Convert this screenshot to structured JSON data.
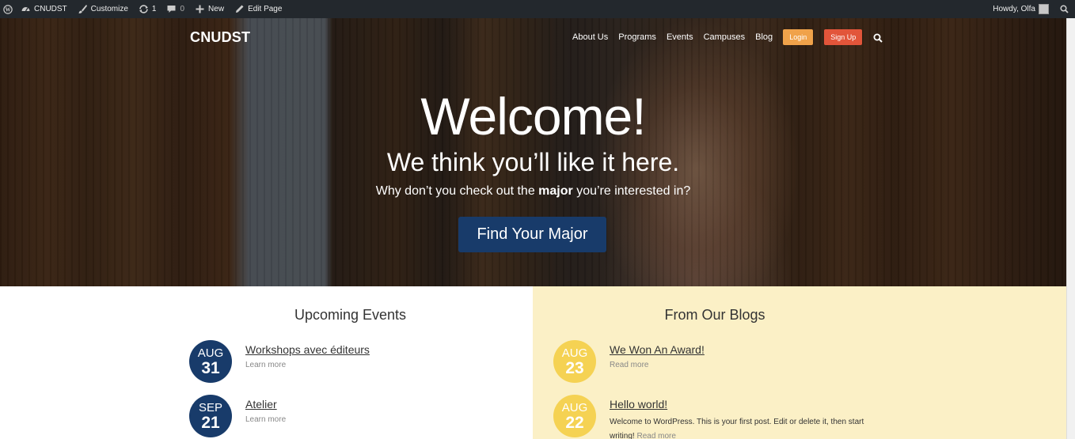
{
  "adminbar": {
    "site_name": "CNUDST",
    "customize": "Customize",
    "updates_count": "1",
    "comments_count": "0",
    "new": "New",
    "edit_page": "Edit Page",
    "howdy": "Howdy, Olfa"
  },
  "header": {
    "logo": "CNUDST",
    "nav": [
      "About Us",
      "Programs",
      "Events",
      "Campuses",
      "Blog"
    ],
    "login": "Login",
    "signup": "Sign Up"
  },
  "hero": {
    "title": "Welcome!",
    "subtitle": "We think you’ll like it here.",
    "line_before": "Why don’t you check out the ",
    "line_bold": "major",
    "line_after": " you’re interested in?",
    "cta": "Find Your Major"
  },
  "events": {
    "title": "Upcoming Events",
    "items": [
      {
        "month": "AUG",
        "day": "31",
        "title": "Workshops avec éditeurs",
        "more": "Learn more"
      },
      {
        "month": "SEP",
        "day": "21",
        "title": "Atelier",
        "more": "Learn more"
      }
    ]
  },
  "blogs": {
    "title": "From Our Blogs",
    "items": [
      {
        "month": "AUG",
        "day": "23",
        "title": "We Won An Award!",
        "more": "Read more",
        "desc": ""
      },
      {
        "month": "AUG",
        "day": "22",
        "title": "Hello world!",
        "more": "Read more",
        "desc": "Welcome to WordPress. This is your first post. Edit or delete it, then start writing!"
      }
    ]
  },
  "colors": {
    "adminbar": "#23282d",
    "brand_blue": "#183b6a",
    "login_orange": "#f0a24a",
    "signup_red": "#e2553a",
    "blog_bg": "#fbf0c6",
    "blog_circle": "#f5d253"
  },
  "icons": {
    "wp": "wordpress-icon",
    "site": "dashboard-icon",
    "customize": "brush-icon",
    "updates": "refresh-icon",
    "comments": "comment-icon",
    "new": "plus-icon",
    "edit": "pencil-icon",
    "search": "search-icon"
  }
}
